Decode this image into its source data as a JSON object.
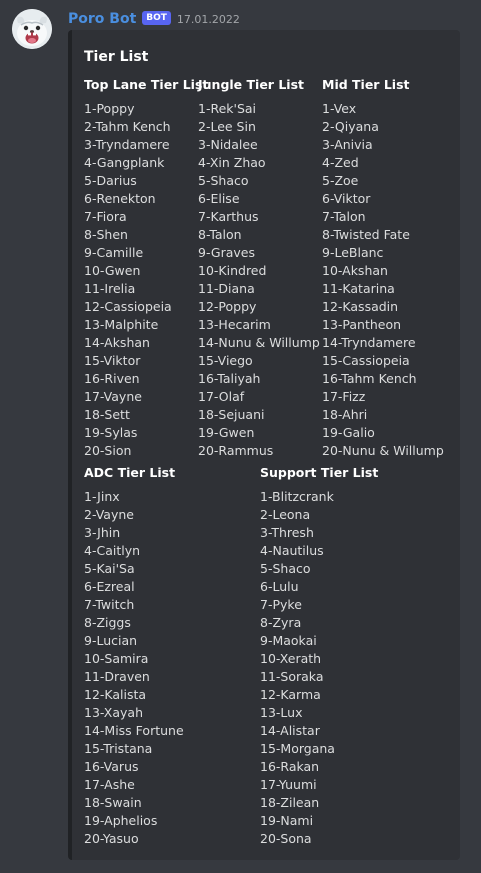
{
  "message": {
    "username": "Poro Bot",
    "bot_tag": "BOT",
    "timestamp": "17.01.2022",
    "avatar_icon": "poro-avatar-icon"
  },
  "embed": {
    "title": "Tier List",
    "columns": [
      {
        "name": "Top Lane Tier List",
        "items": [
          "1-Poppy",
          "2-Tahm Kench",
          "3-Tryndamere",
          "4-Gangplank",
          "5-Darius",
          "6-Renekton",
          "7-Fiora",
          "8-Shen",
          "9-Camille",
          "10-Gwen",
          "11-Irelia",
          "12-Cassiopeia",
          "13-Malphite",
          "14-Akshan",
          "15-Viktor",
          "16-Riven",
          "17-Vayne",
          "18-Sett",
          "19-Sylas",
          "20-Sion"
        ]
      },
      {
        "name": "Jungle Tier List",
        "items": [
          "1-Rek'Sai",
          "2-Lee Sin",
          "3-Nidalee",
          "4-Xin Zhao",
          "5-Shaco",
          "6-Elise",
          "7-Karthus",
          "8-Talon",
          "9-Graves",
          "10-Kindred",
          "11-Diana",
          "12-Poppy",
          "13-Hecarim",
          "14-Nunu & Willump",
          "15-Viego",
          "16-Taliyah",
          "17-Olaf",
          "18-Sejuani",
          "19-Gwen",
          "20-Rammus"
        ]
      },
      {
        "name": "Mid Tier List",
        "items": [
          "1-Vex",
          "2-Qiyana",
          "3-Anivia",
          "4-Zed",
          "5-Zoe",
          "6-Viktor",
          "7-Talon",
          "8-Twisted Fate",
          "9-LeBlanc",
          "10-Akshan",
          "11-Katarina",
          "12-Kassadin",
          "13-Pantheon",
          "14-Tryndamere",
          "15-Cassiopeia",
          "16-Tahm Kench",
          "17-Fizz",
          "18-Ahri",
          "19-Galio",
          "20-Nunu & Willump"
        ]
      },
      {
        "name": "ADC Tier List",
        "items": [
          "1-Jinx",
          "2-Vayne",
          "3-Jhin",
          "4-Caitlyn",
          "5-Kai'Sa",
          "6-Ezreal",
          "7-Twitch",
          "8-Ziggs",
          "9-Lucian",
          "10-Samira",
          "11-Draven",
          "12-Kalista",
          "13-Xayah",
          "14-Miss Fortune",
          "15-Tristana",
          "16-Varus",
          "17-Ashe",
          "18-Swain",
          "19-Aphelios",
          "20-Yasuo"
        ]
      },
      {
        "name": "Support Tier List",
        "items": [
          "1-Blitzcrank",
          "2-Leona",
          "3-Thresh",
          "4-Nautilus",
          "5-Shaco",
          "6-Lulu",
          "7-Pyke",
          "8-Zyra",
          "9-Maokai",
          "10-Xerath",
          "11-Soraka",
          "12-Karma",
          "13-Lux",
          "14-Alistar",
          "15-Morgana",
          "16-Rakan",
          "17-Yuumi",
          "18-Zilean",
          "19-Nami",
          "20-Sona"
        ]
      }
    ]
  }
}
